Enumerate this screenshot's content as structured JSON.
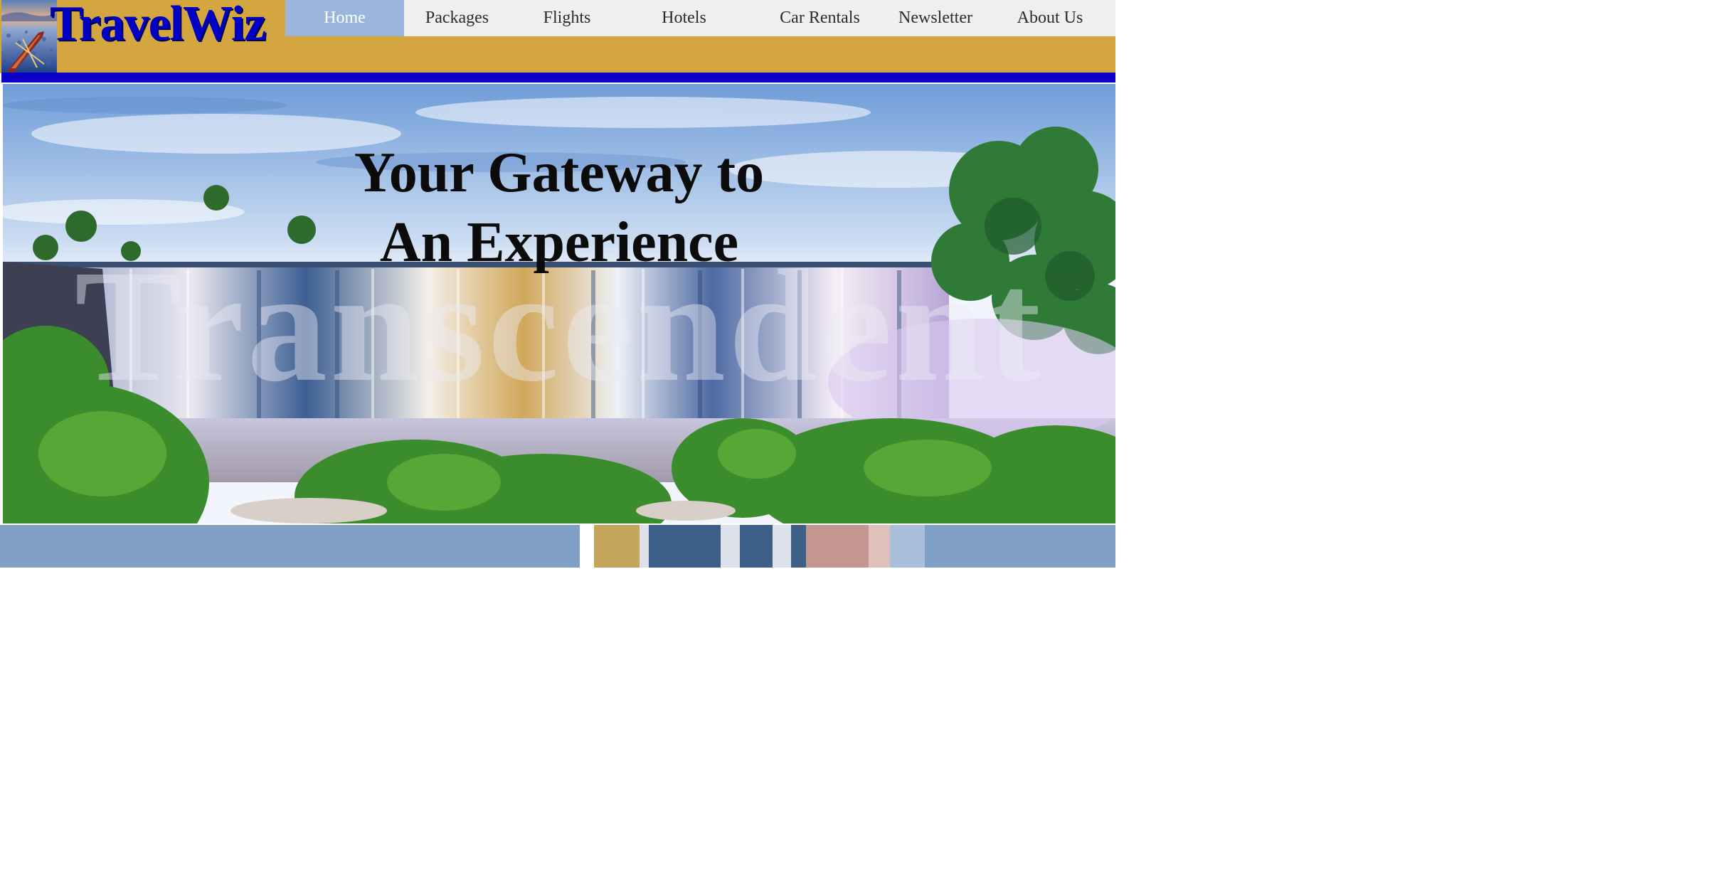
{
  "brand": {
    "name": "TravelWiz",
    "logo_icon": "canoe-on-lake-painting"
  },
  "nav": {
    "items": [
      {
        "label": "Home",
        "active": true
      },
      {
        "label": "Packages",
        "active": false
      },
      {
        "label": "Flights",
        "active": false
      },
      {
        "label": "Hotels",
        "active": false
      },
      {
        "label": "Car Rentals",
        "active": false
      },
      {
        "label": "Newsletter",
        "active": false
      },
      {
        "label": "About Us",
        "active": false
      }
    ]
  },
  "hero": {
    "title_line1": "Your Gateway to",
    "title_line2": "An Experience",
    "watermark": "Transcendent",
    "image": "waterfall-landscape"
  },
  "colors": {
    "header_bg": "#d3a640",
    "logo_text": "#0000c4",
    "nav_bg": "#efefef",
    "nav_active_bg": "#9bb6dc",
    "accent_bar": "#0a00c8",
    "strip": [
      "#7f9fc5",
      "#ffffff",
      "#c4a55a",
      "#dde2ea",
      "#3e5f87",
      "#dde2ea",
      "#3e5f87",
      "#dde2ea",
      "#3e5f87",
      "#c39690",
      "#dfc0bb",
      "#a9bfdb",
      "#7f9fc5"
    ]
  }
}
